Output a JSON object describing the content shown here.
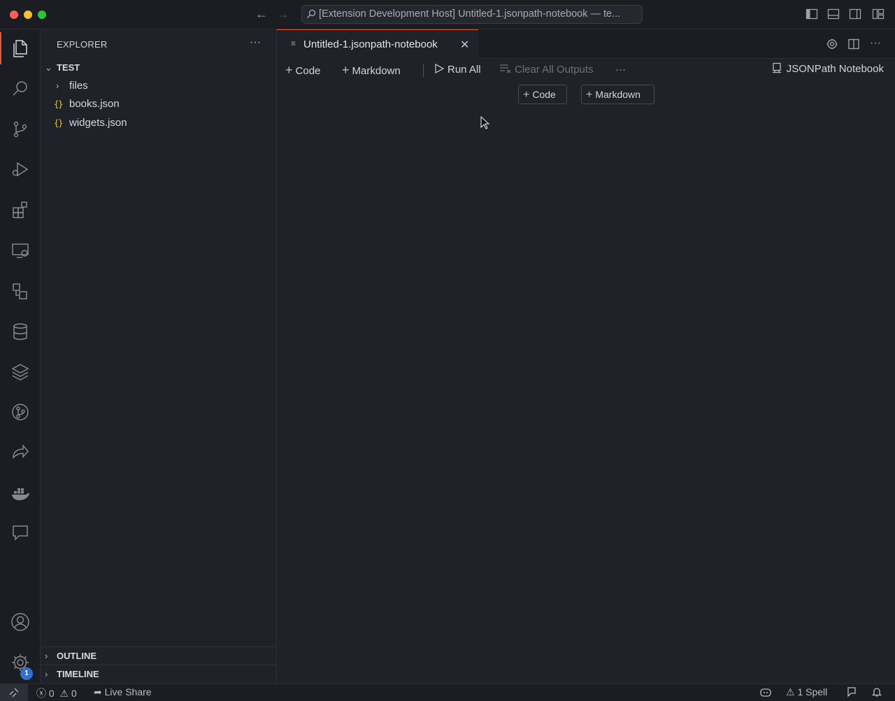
{
  "window": {
    "title": "[Extension Development Host] Untitled-1.jsonpath-notebook — te..."
  },
  "sidebar": {
    "header": "EXPLORER",
    "more": "···",
    "root_folder": "TEST",
    "items": [
      {
        "label": "files",
        "type": "folder"
      },
      {
        "label": "books.json",
        "type": "json"
      },
      {
        "label": "widgets.json",
        "type": "json"
      }
    ],
    "json_icon": "{}",
    "outline": "OUTLINE",
    "timeline": "TIMELINE"
  },
  "activitybar": {
    "items": [
      "explorer-icon",
      "search-icon",
      "source-control-icon",
      "run-debug-icon",
      "extensions-icon",
      "remote-explorer-icon",
      "shapes-icon",
      "database-icon",
      "layers-icon",
      "git-graph-icon",
      "live-share-icon",
      "docker-icon",
      "comments-icon"
    ],
    "settings_badge": "1"
  },
  "editor": {
    "tab_label": "Untitled-1.jsonpath-notebook",
    "toolbar": {
      "code": "Code",
      "markdown": "Markdown",
      "run_all": "Run All",
      "clear_outputs": "Clear All Outputs",
      "more": "···",
      "kernel": "JSONPath Notebook"
    },
    "insert": {
      "code": "Code",
      "markdown": "Markdown"
    }
  },
  "statusbar": {
    "errors": "0",
    "warnings": "0",
    "live_share": "Live Share",
    "spell": "1 Spell"
  },
  "colors": {
    "accent": "#e05a3a",
    "badge": "#2f6fd6",
    "json_icon": "#d9c84a"
  }
}
